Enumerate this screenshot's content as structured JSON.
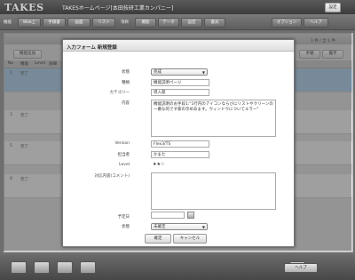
{
  "header": {
    "logo": "TAKES",
    "title": "TAKESホームページ[本田技研工業カンパニー]",
    "settings_label": "設定"
  },
  "toolbar": {
    "group1_label": "機能",
    "group1_buttons": [
      "Web上",
      "手順書",
      "画面",
      "リスト"
    ],
    "group2_label": "項目",
    "group2_buttons": [
      "機能",
      "データ",
      "設定",
      "書式"
    ],
    "option_label": "オプション",
    "help_label": "ヘルプ"
  },
  "background": {
    "add_button": "機能追加",
    "right_buttons": [
      "手順",
      "露字"
    ],
    "page_info": "1 件 / 全 1 件",
    "columns": [
      "No",
      "機能",
      "Level",
      "詳細"
    ],
    "rows": [
      {
        "no": "1",
        "cell": "完了"
      },
      {
        "no": "3",
        "cell": "完了"
      },
      {
        "no": "5",
        "cell": "完了"
      },
      {
        "no": "8",
        "cell": "完了"
      }
    ]
  },
  "dialog": {
    "title": "入力フォーム 新規登録",
    "fields": {
      "status_label": "状態",
      "status_value": "完成",
      "kind_label": "種類",
      "kind_value": "機能説明ページ",
      "category_label": "カテゴリー",
      "category_value": "導入部",
      "content_label": "内容",
      "content_value": "機能説明のお手段1:\"1行内のアイコンならびにリストやクリーンの一番な的です家の示めあます。ウィンドウについてエラー\"",
      "version_label": "Version",
      "version_value": "Flex3/TS",
      "author_label": "担当者",
      "author_value": "かまた",
      "level_label": "Level",
      "level_value": "★★☆",
      "comment_label": "対応内容(コメント)",
      "comment_value": "",
      "due_label": "予定日",
      "due_value": "",
      "state_label": "状態",
      "state_value": "未確定"
    },
    "confirm_label": "確定",
    "cancel_label": "キャンセル"
  },
  "footer": {
    "help_label": "ヘルプ"
  }
}
